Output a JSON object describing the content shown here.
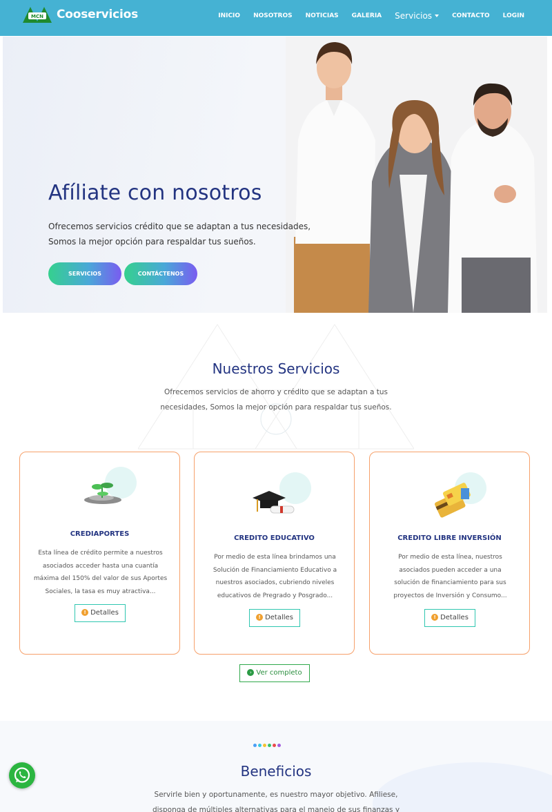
{
  "header": {
    "brand": "Cooservicios",
    "nav": [
      {
        "label": "INICIO"
      },
      {
        "label": "NOSOTROS"
      },
      {
        "label": "NOTICIAS"
      },
      {
        "label": "GALERIA"
      },
      {
        "label": "Servicios"
      },
      {
        "label": "CONTACTO"
      },
      {
        "label": "LOGIN"
      }
    ]
  },
  "hero": {
    "title": "Afíliate con nosotros",
    "text_line1": "Ofrecemos servicios crédito que se adaptan a tus necesidades,",
    "text_line2": "Somos la mejor opción para respaldar tus sueños.",
    "btn_servicios": "SERVICIOS",
    "btn_contact": "CONTÁCTENOS"
  },
  "services": {
    "title": "Nuestros Servicios",
    "text_line1": "Ofrecemos servicios de ahorro y crédito que se adaptan a tus",
    "text_line2": "necesidades, Somos la mejor opción para respaldar tus sueños.",
    "cards": [
      {
        "title": "CREDIAPORTES",
        "lines": [
          "Esta línea de crédito permite a nuestros",
          "asociados acceder hasta una cuantía",
          "máxima del 150% del valor de sus Aportes",
          "Sociales, la tasa es muy atractiva..."
        ],
        "button": "Detalles",
        "icon": "plant-coins-icon"
      },
      {
        "title": "CREDITO EDUCATIVO",
        "lines": [
          "Por medio de esta línea brindamos una",
          "Solución de Financiamiento Educativo a",
          "nuestros asociados, cubriendo niveles",
          "educativos de Pregrado y Posgrado..."
        ],
        "button": "Detalles",
        "icon": "graduation-cap-icon"
      },
      {
        "title": "CREDITO LIBRE INVERSIÓN",
        "lines": [
          "Por medio de esta línea, nuestros",
          "asociados pueden acceder a una",
          "solución de financiamiento para sus",
          "proyectos de Inversión y Consumo..."
        ],
        "button": "Detalles",
        "icon": "credit-cards-icon"
      }
    ],
    "ver_completo": "Ver completo"
  },
  "benefits": {
    "title": "Beneficios",
    "text_line1": "Servirle bien y oportunamente, es nuestro mayor objetivo. Afiliese,",
    "text_line2": "disponga de múltiples alternativas para el manejo de sus finanzas y",
    "dot_colors": [
      "#4a9ff5",
      "#38c9e0",
      "#f2c230",
      "#37c26a",
      "#e94b4b",
      "#a35de0"
    ]
  },
  "colors": {
    "nav_bg": "#45b2d3",
    "title_blue": "#233481",
    "card_border": "#f6a06a",
    "whatsapp": "#2bb540"
  }
}
